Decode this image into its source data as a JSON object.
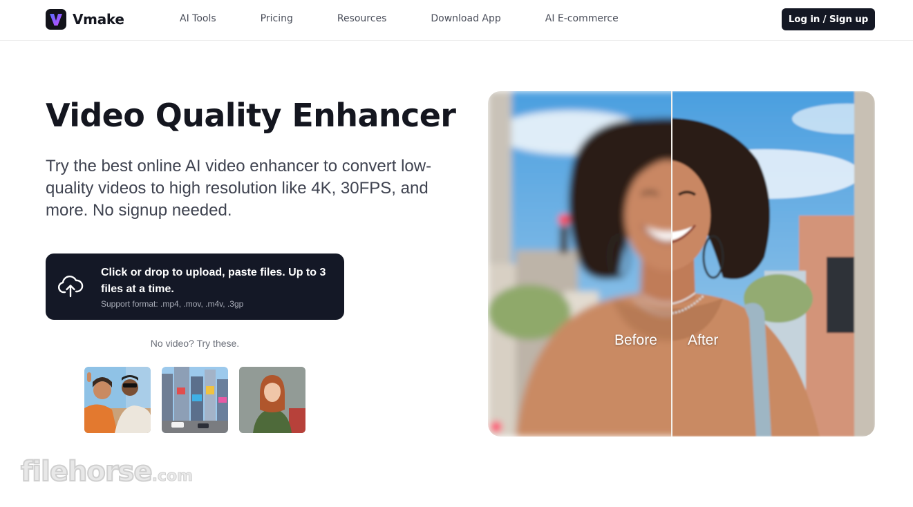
{
  "header": {
    "logo_text": "Vmake",
    "nav": [
      "AI Tools",
      "Pricing",
      "Resources",
      "Download App",
      "AI E-commerce"
    ],
    "login_label": "Log in / Sign up"
  },
  "hero": {
    "title": "Video Quality Enhancer",
    "subtitle": "Try the best online AI video enhancer to convert low-quality videos to high resolution like 4K, 30FPS, and more. No signup needed.",
    "upload": {
      "main_text": "Click or drop to upload, paste files. Up to 3 files at a time.",
      "formats": "Support format: .mp4, .mov, .m4v, .3gp"
    },
    "try_label": "No video? Try these.",
    "samples": [
      "friends-selfie",
      "city-street",
      "woman-portrait"
    ]
  },
  "preview": {
    "before_label": "Before",
    "after_label": "After"
  },
  "watermark": {
    "text": "filehorse",
    "suffix": ".com"
  },
  "colors": {
    "primary_dark": "#141824",
    "text_dark": "#14161f",
    "text_muted": "#6a6e78",
    "logo_gradient_start": "#5b6cff",
    "logo_gradient_end": "#c44dff"
  }
}
